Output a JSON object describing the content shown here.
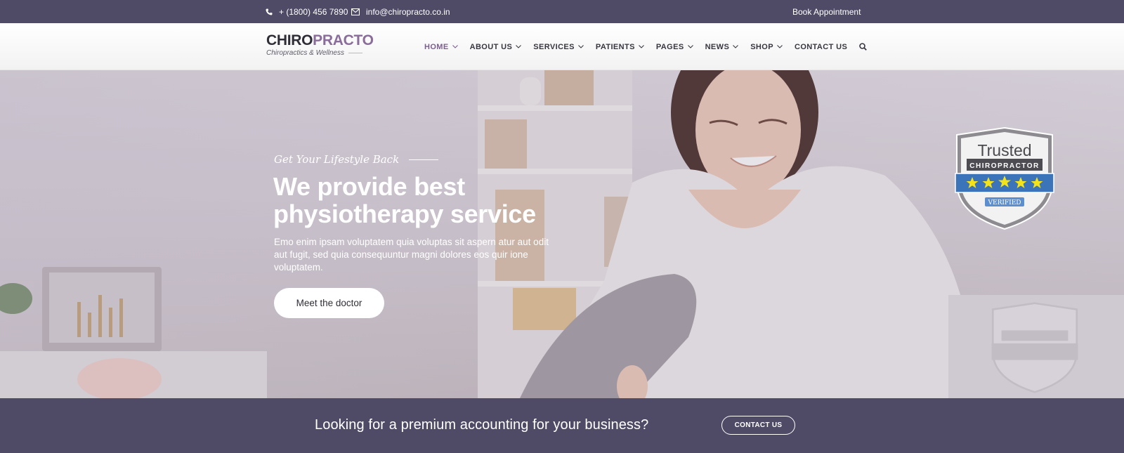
{
  "topbar": {
    "phone": "+ (1800) 456 7890",
    "email": "info@chiropracto.co.in",
    "book": "Book Appointment"
  },
  "logo": {
    "part1": "CHIRO",
    "part2": "PRACTO",
    "tagline": "Chiropractics & Wellness"
  },
  "nav": {
    "items": [
      {
        "label": "HOME"
      },
      {
        "label": "ABOUT US"
      },
      {
        "label": "SERVICES"
      },
      {
        "label": "PATIENTS"
      },
      {
        "label": "PAGES"
      },
      {
        "label": "NEWS"
      },
      {
        "label": "SHOP"
      },
      {
        "label": "CONTACT US"
      }
    ]
  },
  "hero": {
    "tagline": "Get Your Lifestyle Back",
    "headline": "We provide best physiotherapy service",
    "description": "Emo enim ipsam voluptatem quia voluptas sit aspern atur aut odit aut fugit, sed quia consequuntur magni dolores eos quir ione voluptatem.",
    "button": "Meet the doctor"
  },
  "badge": {
    "title": "Trusted",
    "subtitle": "CHIROPRACTOR",
    "verified": "VERIFIED"
  },
  "cta": {
    "text": "Looking for a premium accounting for your business?",
    "button": "CONTACT US"
  },
  "colors": {
    "band": "#4f4a66",
    "accent": "#8a6d9b",
    "badge_blue": "#3b74b9",
    "star": "#f4e21a"
  }
}
